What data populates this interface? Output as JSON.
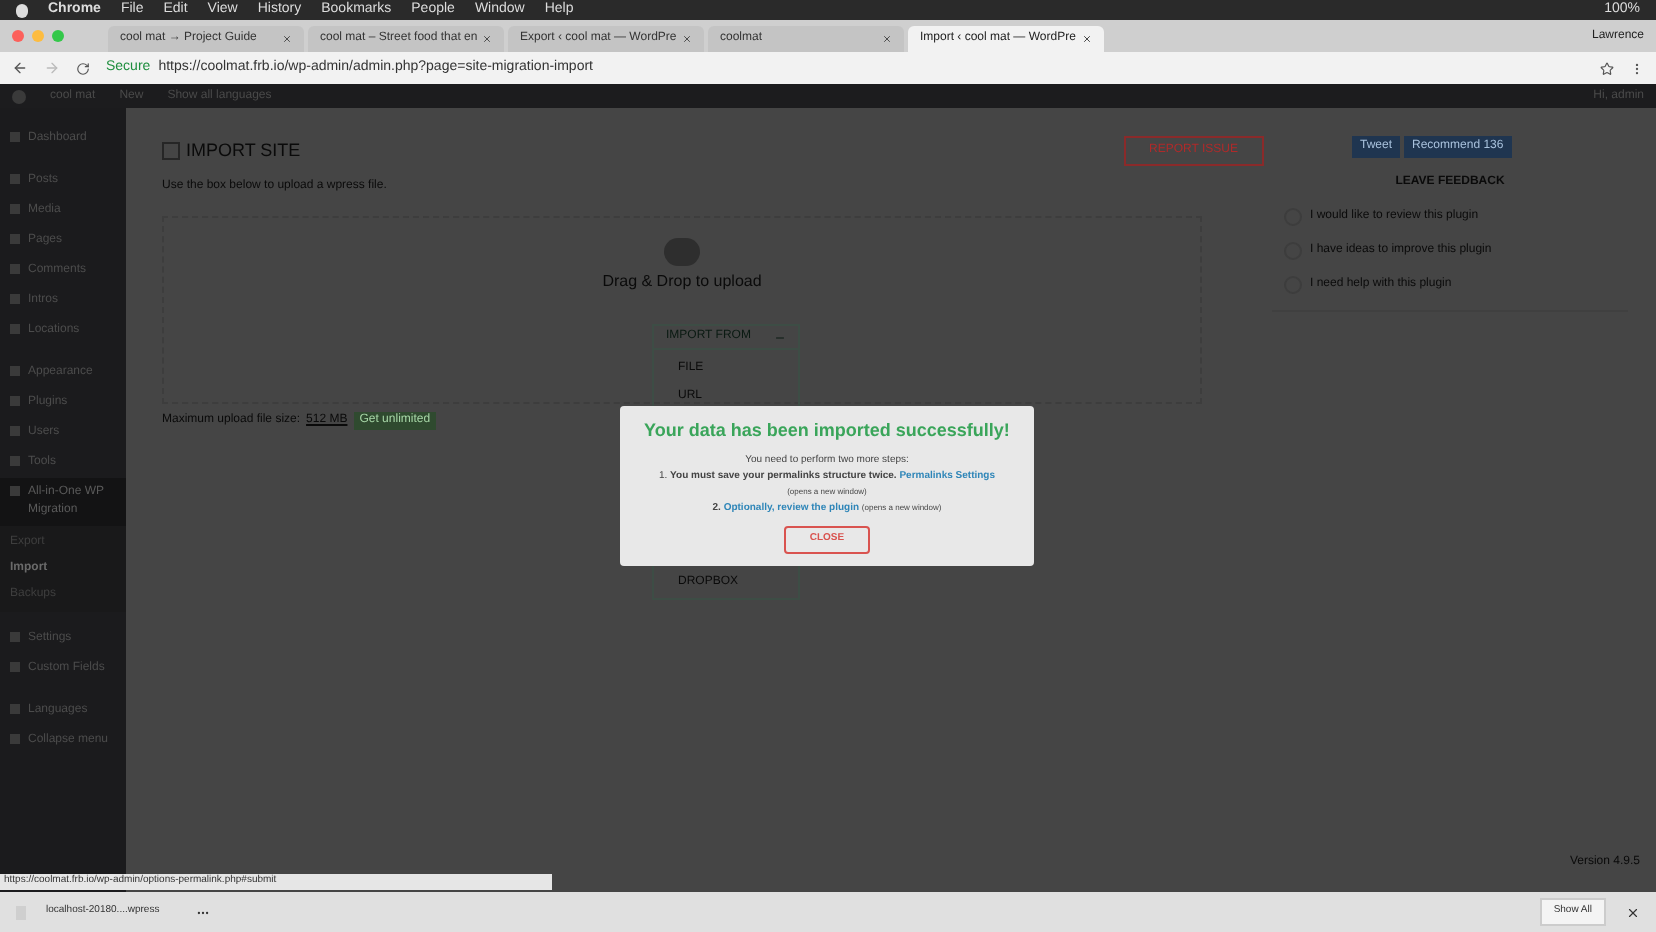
{
  "menubar": {
    "items": [
      "Chrome",
      "File",
      "Edit",
      "View",
      "History",
      "Bookmarks",
      "People",
      "Window",
      "Help"
    ],
    "battery": "100%"
  },
  "tabs": [
    {
      "label": "cool mat → Project Guide",
      "selected": false
    },
    {
      "label": "cool mat – Street food that en",
      "selected": false
    },
    {
      "label": "Export ‹ cool mat — WordPre",
      "selected": false
    },
    {
      "label": "coolmat",
      "selected": false
    },
    {
      "label": "Import ‹ cool mat — WordPre",
      "selected": true
    }
  ],
  "profile": "Lawrence",
  "address": {
    "secure": "Secure",
    "url": "https://coolmat.frb.io/wp-admin/admin.php?page=site-migration-import"
  },
  "admin_bar": {
    "items": [
      "cool mat",
      "New",
      "Show all languages"
    ],
    "user": "Hi, admin"
  },
  "sidebar": {
    "items": [
      {
        "label": "Dashboard",
        "selected": false
      },
      {
        "label": "Posts",
        "selected": false
      },
      {
        "label": "Media",
        "selected": false
      },
      {
        "label": "Pages",
        "selected": false
      },
      {
        "label": "Comments",
        "selected": false
      },
      {
        "label": "Intros",
        "selected": false
      },
      {
        "label": "Locations",
        "selected": false
      },
      {
        "label": "Appearance",
        "selected": false
      },
      {
        "label": "Plugins",
        "selected": false
      },
      {
        "label": "Users",
        "selected": false
      },
      {
        "label": "Tools",
        "selected": false
      },
      {
        "label": "All-in-One WP Migration",
        "selected": true,
        "children": [
          {
            "label": "Export",
            "selected": false
          },
          {
            "label": "Import",
            "selected": true
          },
          {
            "label": "Backups",
            "selected": false
          }
        ]
      },
      {
        "label": "Settings",
        "selected": false
      },
      {
        "label": "Custom Fields",
        "selected": false
      },
      {
        "label": "Languages",
        "selected": false
      },
      {
        "label": "Collapse menu",
        "selected": false
      }
    ]
  },
  "page": {
    "title": "IMPORT SITE",
    "report": "REPORT ISSUE",
    "intro": "Use the box below to upload a wpress file.",
    "drop": "Drag & Drop to upload",
    "import_from": "IMPORT FROM",
    "sources": [
      "FILE",
      "URL",
      "DROPBOX"
    ],
    "max_size": "Maximum upload file size:",
    "size": "512 MB",
    "unlimited": "Get unlimited"
  },
  "social": [
    "Tweet",
    "Recommend 136"
  ],
  "feedback": {
    "title": "LEAVE FEEDBACK",
    "options": [
      {
        "label": "I would like to review this plugin",
        "selected": false
      },
      {
        "label": "I have ideas to improve this plugin",
        "selected": false
      },
      {
        "label": "I need help with this plugin",
        "selected": false
      }
    ]
  },
  "modal": {
    "title": "Your data has been imported successfully!",
    "lead": "You need to perform two more steps:",
    "step1": "1. **You must save your permalinks structure twice.**",
    "step1_link": "Permalinks Settings",
    "step1_note": "(opens a new window)",
    "step2": "2.",
    "step2_link": "Optionally, review the plugin",
    "step2_note": "(opens a new window)",
    "close": "CLOSE"
  },
  "version": "Version 4.9.5",
  "status_link": "https://coolmat.frb.io/wp-admin/options-permalink.php#submit",
  "download": {
    "file": "localhost-20180....wpress",
    "show_all": "Show All"
  }
}
